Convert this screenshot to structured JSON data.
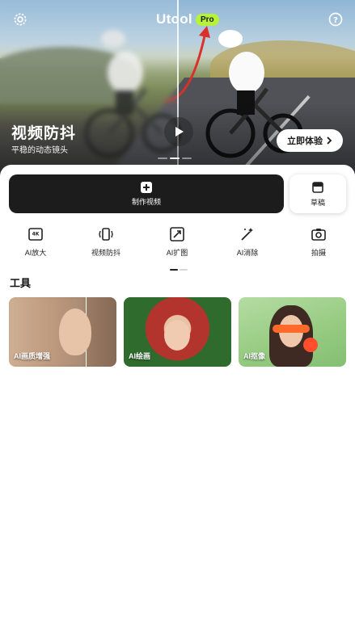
{
  "app": {
    "brand": "Utool",
    "badge": "Pro"
  },
  "hero": {
    "title": "视频防抖",
    "subtitle": "平稳的动态镜头",
    "cta": "立即体验",
    "slides": 3,
    "active_slide": 1
  },
  "actions": {
    "make_video": "制作视频",
    "drafts": "草稿"
  },
  "features": [
    {
      "label": "AI放大",
      "icon": "ai-upscale-4k-icon"
    },
    {
      "label": "视频防抖",
      "icon": "video-stabilize-icon"
    },
    {
      "label": "AI扩图",
      "icon": "ai-expand-icon"
    },
    {
      "label": "AI消除",
      "icon": "ai-erase-wand-icon"
    },
    {
      "label": "拍摄",
      "icon": "camera-icon"
    }
  ],
  "section": {
    "title": "工具"
  },
  "tools": [
    {
      "label": "AI画质增强"
    },
    {
      "label": "AI绘画"
    },
    {
      "label": "AI抠像"
    }
  ],
  "colors": {
    "accent": "#b5f238",
    "dark_button": "#1c1c1c"
  }
}
